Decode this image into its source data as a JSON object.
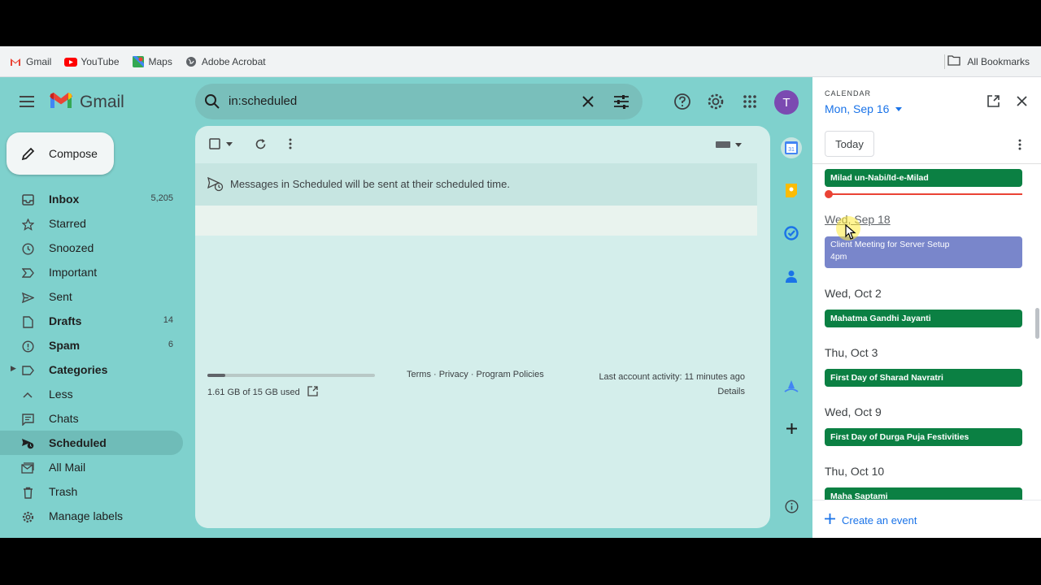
{
  "bookmarks": {
    "items": [
      {
        "label": "Gmail",
        "icon": "gmail-icon"
      },
      {
        "label": "YouTube",
        "icon": "youtube-icon"
      },
      {
        "label": "Maps",
        "icon": "maps-icon"
      },
      {
        "label": "Adobe Acrobat",
        "icon": "globe-icon"
      }
    ],
    "all_bookmarks": "All Bookmarks"
  },
  "header": {
    "app_name": "Gmail",
    "search_value": "in:scheduled",
    "avatar_letter": "T",
    "accent": "#7b4ab1"
  },
  "sidebar": {
    "compose_label": "Compose",
    "items": [
      {
        "label": "Inbox",
        "count": "5,205",
        "icon": "inbox-icon",
        "bold": true
      },
      {
        "label": "Starred",
        "count": "",
        "icon": "star-icon"
      },
      {
        "label": "Snoozed",
        "count": "",
        "icon": "clock-icon"
      },
      {
        "label": "Important",
        "count": "",
        "icon": "important-icon"
      },
      {
        "label": "Sent",
        "count": "",
        "icon": "send-icon"
      },
      {
        "label": "Drafts",
        "count": "14",
        "icon": "draft-icon",
        "bold": true
      },
      {
        "label": "Spam",
        "count": "6",
        "icon": "spam-icon",
        "bold": true
      },
      {
        "label": "Categories",
        "count": "",
        "icon": "label-icon",
        "bold": true
      },
      {
        "label": "Less",
        "count": "",
        "icon": "chevron-up-icon"
      },
      {
        "label": "Chats",
        "count": "",
        "icon": "chat-icon"
      },
      {
        "label": "Scheduled",
        "count": "",
        "icon": "scheduled-send-icon",
        "active": true
      },
      {
        "label": "All Mail",
        "count": "",
        "icon": "all-mail-icon"
      },
      {
        "label": "Trash",
        "count": "",
        "icon": "trash-icon"
      },
      {
        "label": "Manage labels",
        "count": "",
        "icon": "gear-icon"
      }
    ]
  },
  "main": {
    "notice": "Messages in Scheduled will be sent at their scheduled time.",
    "storage_used": "1.61 GB of 15 GB used",
    "storage_fraction": 0.107,
    "footer_links": "Terms · Privacy · Program Policies",
    "last_activity": "Last account activity: 11 minutes ago",
    "details": "Details"
  },
  "calendar": {
    "kicker": "CALENDAR",
    "date": "Mon, Sep 16",
    "today_button": "Today",
    "create_event": "Create an event",
    "days": [
      {
        "heading": "",
        "events": [
          {
            "title": "Milad un-Nabi/Id-e-Milad"
          }
        ]
      },
      {
        "heading": "Wed, Sep 18",
        "events": [
          {
            "title": "Client Meeting for Server Setup",
            "time": "4pm"
          }
        ]
      },
      {
        "heading": "Wed, Oct 2",
        "events": [
          {
            "title": "Mahatma Gandhi Jayanti"
          }
        ]
      },
      {
        "heading": "Thu, Oct 3",
        "events": [
          {
            "title": "First Day of Sharad Navratri"
          }
        ]
      },
      {
        "heading": "Wed, Oct 9",
        "events": [
          {
            "title": "First Day of Durga Puja Festivities"
          }
        ]
      },
      {
        "heading": "Thu, Oct 10",
        "events": [
          {
            "title": "Maha Saptami"
          }
        ]
      }
    ]
  }
}
